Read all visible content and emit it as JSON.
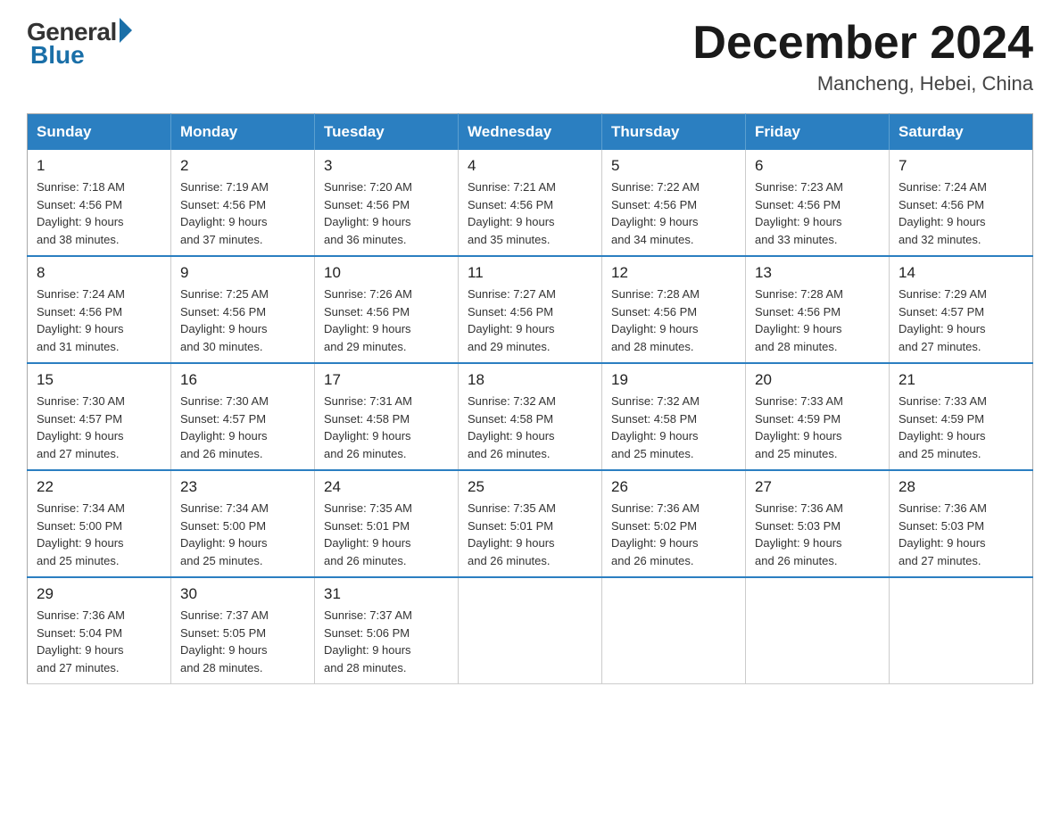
{
  "logo": {
    "general": "General",
    "blue": "Blue"
  },
  "title": {
    "month": "December 2024",
    "location": "Mancheng, Hebei, China"
  },
  "days_of_week": [
    "Sunday",
    "Monday",
    "Tuesday",
    "Wednesday",
    "Thursday",
    "Friday",
    "Saturday"
  ],
  "weeks": [
    [
      {
        "day": "1",
        "sunrise": "7:18 AM",
        "sunset": "4:56 PM",
        "daylight": "9 hours and 38 minutes."
      },
      {
        "day": "2",
        "sunrise": "7:19 AM",
        "sunset": "4:56 PM",
        "daylight": "9 hours and 37 minutes."
      },
      {
        "day": "3",
        "sunrise": "7:20 AM",
        "sunset": "4:56 PM",
        "daylight": "9 hours and 36 minutes."
      },
      {
        "day": "4",
        "sunrise": "7:21 AM",
        "sunset": "4:56 PM",
        "daylight": "9 hours and 35 minutes."
      },
      {
        "day": "5",
        "sunrise": "7:22 AM",
        "sunset": "4:56 PM",
        "daylight": "9 hours and 34 minutes."
      },
      {
        "day": "6",
        "sunrise": "7:23 AM",
        "sunset": "4:56 PM",
        "daylight": "9 hours and 33 minutes."
      },
      {
        "day": "7",
        "sunrise": "7:24 AM",
        "sunset": "4:56 PM",
        "daylight": "9 hours and 32 minutes."
      }
    ],
    [
      {
        "day": "8",
        "sunrise": "7:24 AM",
        "sunset": "4:56 PM",
        "daylight": "9 hours and 31 minutes."
      },
      {
        "day": "9",
        "sunrise": "7:25 AM",
        "sunset": "4:56 PM",
        "daylight": "9 hours and 30 minutes."
      },
      {
        "day": "10",
        "sunrise": "7:26 AM",
        "sunset": "4:56 PM",
        "daylight": "9 hours and 29 minutes."
      },
      {
        "day": "11",
        "sunrise": "7:27 AM",
        "sunset": "4:56 PM",
        "daylight": "9 hours and 29 minutes."
      },
      {
        "day": "12",
        "sunrise": "7:28 AM",
        "sunset": "4:56 PM",
        "daylight": "9 hours and 28 minutes."
      },
      {
        "day": "13",
        "sunrise": "7:28 AM",
        "sunset": "4:56 PM",
        "daylight": "9 hours and 28 minutes."
      },
      {
        "day": "14",
        "sunrise": "7:29 AM",
        "sunset": "4:57 PM",
        "daylight": "9 hours and 27 minutes."
      }
    ],
    [
      {
        "day": "15",
        "sunrise": "7:30 AM",
        "sunset": "4:57 PM",
        "daylight": "9 hours and 27 minutes."
      },
      {
        "day": "16",
        "sunrise": "7:30 AM",
        "sunset": "4:57 PM",
        "daylight": "9 hours and 26 minutes."
      },
      {
        "day": "17",
        "sunrise": "7:31 AM",
        "sunset": "4:58 PM",
        "daylight": "9 hours and 26 minutes."
      },
      {
        "day": "18",
        "sunrise": "7:32 AM",
        "sunset": "4:58 PM",
        "daylight": "9 hours and 26 minutes."
      },
      {
        "day": "19",
        "sunrise": "7:32 AM",
        "sunset": "4:58 PM",
        "daylight": "9 hours and 25 minutes."
      },
      {
        "day": "20",
        "sunrise": "7:33 AM",
        "sunset": "4:59 PM",
        "daylight": "9 hours and 25 minutes."
      },
      {
        "day": "21",
        "sunrise": "7:33 AM",
        "sunset": "4:59 PM",
        "daylight": "9 hours and 25 minutes."
      }
    ],
    [
      {
        "day": "22",
        "sunrise": "7:34 AM",
        "sunset": "5:00 PM",
        "daylight": "9 hours and 25 minutes."
      },
      {
        "day": "23",
        "sunrise": "7:34 AM",
        "sunset": "5:00 PM",
        "daylight": "9 hours and 25 minutes."
      },
      {
        "day": "24",
        "sunrise": "7:35 AM",
        "sunset": "5:01 PM",
        "daylight": "9 hours and 26 minutes."
      },
      {
        "day": "25",
        "sunrise": "7:35 AM",
        "sunset": "5:01 PM",
        "daylight": "9 hours and 26 minutes."
      },
      {
        "day": "26",
        "sunrise": "7:36 AM",
        "sunset": "5:02 PM",
        "daylight": "9 hours and 26 minutes."
      },
      {
        "day": "27",
        "sunrise": "7:36 AM",
        "sunset": "5:03 PM",
        "daylight": "9 hours and 26 minutes."
      },
      {
        "day": "28",
        "sunrise": "7:36 AM",
        "sunset": "5:03 PM",
        "daylight": "9 hours and 27 minutes."
      }
    ],
    [
      {
        "day": "29",
        "sunrise": "7:36 AM",
        "sunset": "5:04 PM",
        "daylight": "9 hours and 27 minutes."
      },
      {
        "day": "30",
        "sunrise": "7:37 AM",
        "sunset": "5:05 PM",
        "daylight": "9 hours and 28 minutes."
      },
      {
        "day": "31",
        "sunrise": "7:37 AM",
        "sunset": "5:06 PM",
        "daylight": "9 hours and 28 minutes."
      },
      null,
      null,
      null,
      null
    ]
  ],
  "labels": {
    "sunrise": "Sunrise:",
    "sunset": "Sunset:",
    "daylight": "Daylight:"
  }
}
